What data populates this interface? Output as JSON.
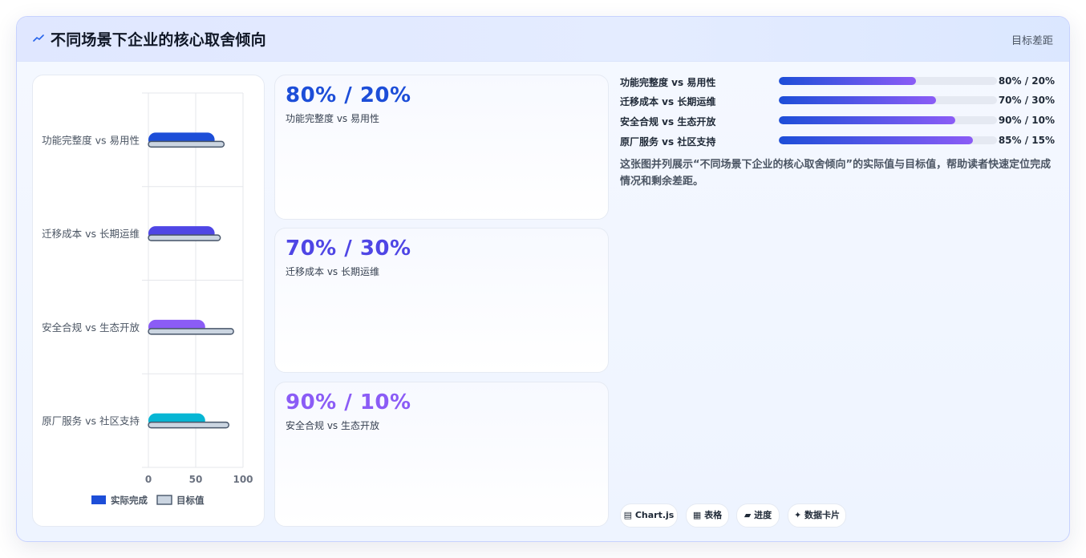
{
  "header": {
    "title": "不同场景下企业的核心取舍倾向",
    "right_label": "目标差距",
    "icon": "chart-icon"
  },
  "colors": {
    "accent_blue": "#1d4ed8",
    "accent_indigo": "#4f46e5",
    "accent_purple": "#8b5cf6",
    "accent_cyan": "#06b6d4",
    "target_fill": "#cbd5e1",
    "target_stroke": "#475569"
  },
  "chart_data": {
    "type": "bar",
    "orientation": "horizontal",
    "categories": [
      "功能完整度 vs 易用性",
      "迁移成本 vs 长期运维",
      "安全合规 vs 生态开放",
      "原厂服务 vs 社区支持"
    ],
    "series": [
      {
        "name": "实际完成",
        "values": [
          70,
          70,
          60,
          60
        ],
        "colors": [
          "#1d4ed8",
          "#4f46e5",
          "#8b5cf6",
          "#06b6d4"
        ]
      },
      {
        "name": "目标值",
        "values": [
          80,
          76,
          90,
          85
        ],
        "color": "#cbd5e1"
      }
    ],
    "xlim": [
      0,
      100
    ],
    "xticks": [
      "0",
      "50",
      "100"
    ],
    "legend": "bottom",
    "grid": true
  },
  "stats": [
    {
      "value": "80% / 20%",
      "label": "功能完整度 vs 易用性",
      "color": "#1d4ed8"
    },
    {
      "value": "70% / 30%",
      "label": "迁移成本 vs 长期运维",
      "color": "#4f46e5"
    },
    {
      "value": "90% / 10%",
      "label": "安全合规 vs 生态开放",
      "color": "#8b5cf6"
    }
  ],
  "progress": [
    {
      "label": "功能完整度 vs 易用性",
      "value": "80% / 20%",
      "fraction": 0.63
    },
    {
      "label": "迁移成本 vs 长期运维",
      "value": "70% / 30%",
      "fraction": 0.72
    },
    {
      "label": "安全合规 vs 生态开放",
      "value": "90% / 10%",
      "fraction": 0.81
    },
    {
      "label": "原厂服务 vs 社区支持",
      "value": "85% / 15%",
      "fraction": 0.89
    }
  ],
  "description": "这张图并列展示“不同场景下企业的核心取舍倾向”的实际值与目标值，帮助读者快速定位完成情况和剩余差距。",
  "chips": [
    {
      "label": "▤ Chart.js"
    },
    {
      "label": "▦ 表格"
    },
    {
      "label": "▰ 进度"
    },
    {
      "label": "✦ 数据卡片"
    }
  ]
}
